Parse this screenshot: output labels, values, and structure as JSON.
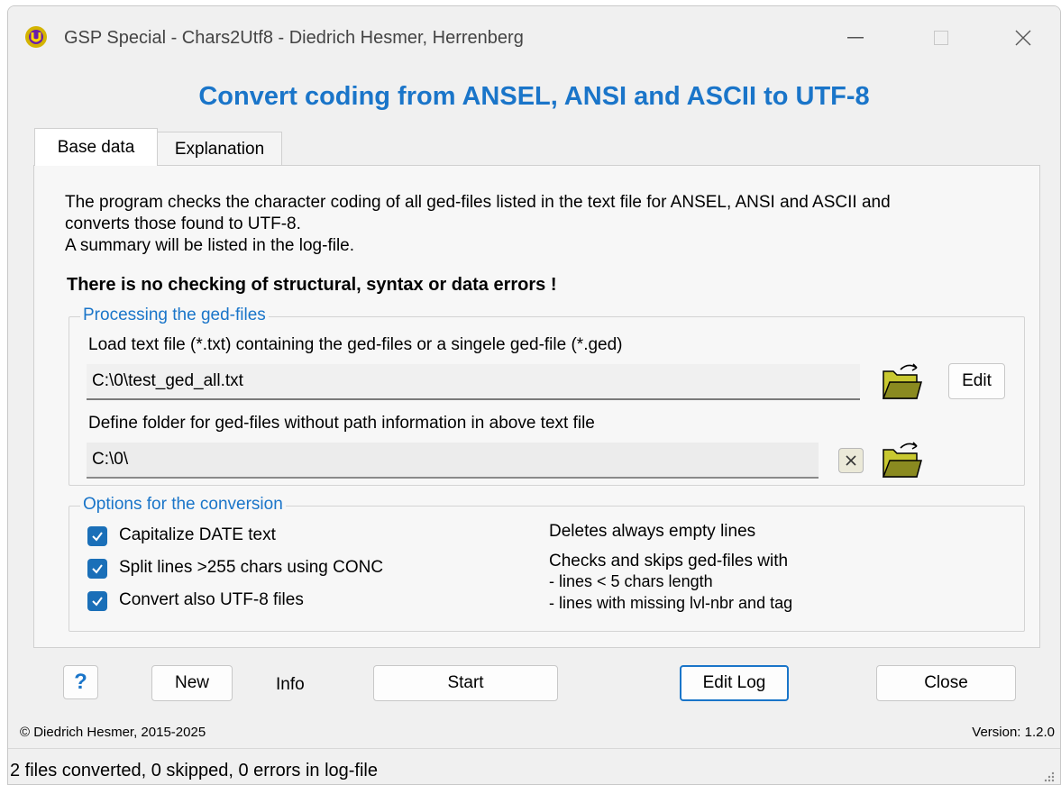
{
  "window": {
    "title": "GSP Special - Chars2Utf8  -  Diedrich Hesmer, Herrenberg",
    "icon": "app-logo-icon"
  },
  "header": "Convert coding from ANSEL, ANSI and ASCII to UTF-8",
  "tabs": [
    {
      "label": "Base data",
      "selected": true
    },
    {
      "label": "Explanation",
      "selected": false
    }
  ],
  "intro": {
    "line1": "The program checks the character coding of all ged-files listed in the text file for ANSEL, ANSI and ASCII and",
    "line2": "converts those found to UTF-8.",
    "line3": "A summary will be listed in the log-file."
  },
  "warning": "There is no checking of structural, syntax or data errors !",
  "processing": {
    "legend": "Processing the ged-files",
    "load_label": "Load text file (*.txt) containing the ged-files or a singele ged-file (*.ged)",
    "load_value": "C:\\0\\test_ged_all.txt",
    "edit_label": "Edit",
    "folder_label": "Define folder for ged-files without path information in above text file",
    "folder_value": "C:\\0\\"
  },
  "options": {
    "legend": "Options for the conversion",
    "checkboxes": [
      {
        "label": "Capitalize DATE text",
        "checked": true
      },
      {
        "label": "Split lines >255 chars using CONC",
        "checked": true
      },
      {
        "label": "Convert also UTF-8 files",
        "checked": true
      }
    ],
    "info_deletes": "Deletes always empty lines",
    "info_checks": "Checks and skips ged-files with",
    "info_line1": " - lines < 5 chars length",
    "info_line2": " - lines with missing lvl-nbr and tag"
  },
  "buttons": {
    "help": "?",
    "new": "New",
    "info": "Info",
    "start": "Start",
    "edit_log": "Edit Log",
    "close": "Close"
  },
  "footer": {
    "copyright": "© Diedrich Hesmer,  2015-2025",
    "version": "Version: 1.2.0"
  },
  "status": "2 files converted, 0 skipped, 0 errors in log-file",
  "colors": {
    "accent": "#1a75c9",
    "checkbox": "#1a6fb8"
  }
}
